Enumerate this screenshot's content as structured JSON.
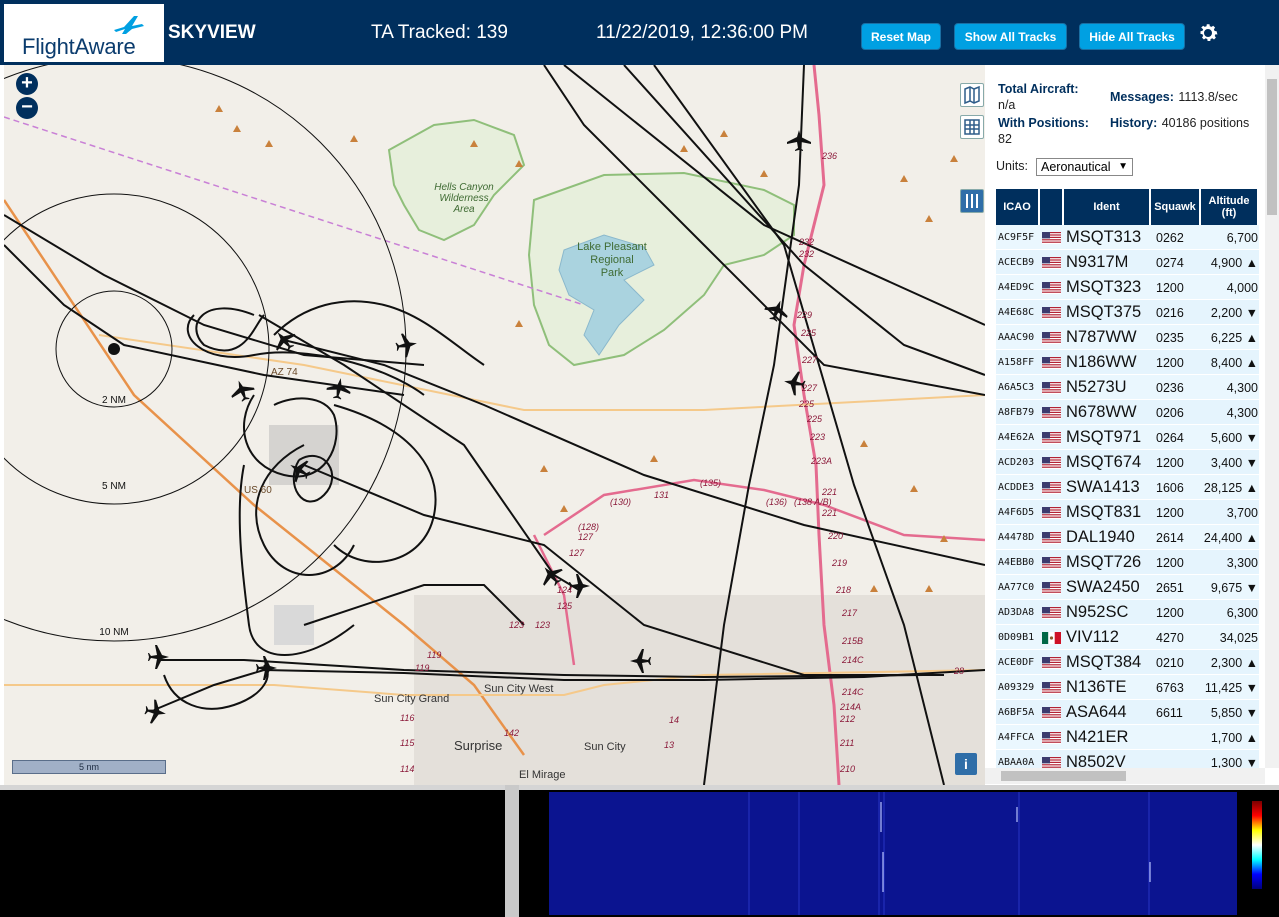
{
  "header": {
    "logo_text": "FlightAware",
    "app_title": "SKYVIEW",
    "tracked_label": "TA Tracked: 139",
    "datetime": "11/22/2019, 12:36:00 PM",
    "buttons": {
      "reset_map": "Reset Map",
      "show_all_tracks": "Show All Tracks",
      "hide_all_tracks": "Hide All Tracks"
    },
    "settings_icon": "gear-icon"
  },
  "map": {
    "zoom_in": "+",
    "zoom_out": "−",
    "range_rings": [
      "2 NM",
      "5 NM",
      "10 NM"
    ],
    "place_labels": {
      "hells_canyon": "Hells Canyon Wilderness Area",
      "lake_pleasant": "Lake Pleasant Regional Park",
      "sun_city_grand": "Sun City Grand",
      "sun_city_west": "Sun City West",
      "surprise": "Surprise",
      "sun_city": "Sun City",
      "el_mirage": "El Mirage"
    },
    "road_labels": [
      "AZ 74",
      "US 60"
    ],
    "exit_labels": [
      "236",
      "232",
      "232",
      "229",
      "225",
      "227",
      "227",
      "225",
      "223",
      "223A",
      "221",
      "221",
      "220",
      "219",
      "218",
      "217",
      "215B",
      "214C",
      "214C",
      "214A",
      "212",
      "211",
      "210",
      "(130)",
      "131",
      "(135)",
      "(136)",
      "(138 A/B)",
      "(128)",
      "127",
      "127",
      "124",
      "125",
      "123",
      "123",
      "119",
      "119",
      "116",
      "115",
      "114",
      "142",
      "14",
      "13",
      "28"
    ],
    "scale_label": "5 nm",
    "info_button": "i",
    "controls": [
      "map-layers-icon",
      "grid-icon",
      "columns-icon"
    ]
  },
  "panel": {
    "total_aircraft_label": "Total Aircraft:",
    "total_aircraft_value": "n/a",
    "with_positions_label": "With Positions:",
    "with_positions_value": "82",
    "messages_label": "Messages:",
    "messages_value": "1113.8/sec",
    "history_label": "History:",
    "history_value": "40186 positions",
    "units_label": "Units:",
    "units_value": "Aeronautical",
    "columns": [
      "ICAO",
      "",
      "Ident",
      "Squawk",
      "Altitude (ft)"
    ],
    "rows": [
      {
        "icao": "AC9F5F",
        "flag": "US",
        "ident": "MSQT313",
        "squawk": "0262",
        "alt": "6,700"
      },
      {
        "icao": "ACECB9",
        "flag": "US",
        "ident": "N9317M",
        "squawk": "0274",
        "alt": "4,900 ▲"
      },
      {
        "icao": "A4ED9C",
        "flag": "US",
        "ident": "MSQT323",
        "squawk": "1200",
        "alt": "4,000"
      },
      {
        "icao": "A4E68C",
        "flag": "US",
        "ident": "MSQT375",
        "squawk": "0216",
        "alt": "2,200 ▼"
      },
      {
        "icao": "AAAC90",
        "flag": "US",
        "ident": "N787WW",
        "squawk": "0235",
        "alt": "6,225 ▲"
      },
      {
        "icao": "A158FF",
        "flag": "US",
        "ident": "N186WW",
        "squawk": "1200",
        "alt": "8,400 ▲"
      },
      {
        "icao": "A6A5C3",
        "flag": "US",
        "ident": "N5273U",
        "squawk": "0236",
        "alt": "4,300"
      },
      {
        "icao": "A8FB79",
        "flag": "US",
        "ident": "N678WW",
        "squawk": "0206",
        "alt": "4,300"
      },
      {
        "icao": "A4E62A",
        "flag": "US",
        "ident": "MSQT971",
        "squawk": "0264",
        "alt": "5,600 ▼"
      },
      {
        "icao": "ACD203",
        "flag": "US",
        "ident": "MSQT674",
        "squawk": "1200",
        "alt": "3,400 ▼"
      },
      {
        "icao": "ACDDE3",
        "flag": "US",
        "ident": "SWA1413",
        "squawk": "1606",
        "alt": "28,125 ▲"
      },
      {
        "icao": "A4F6D5",
        "flag": "US",
        "ident": "MSQT831",
        "squawk": "1200",
        "alt": "3,700"
      },
      {
        "icao": "A4478D",
        "flag": "US",
        "ident": "DAL1940",
        "squawk": "2614",
        "alt": "24,400 ▲"
      },
      {
        "icao": "A4EBB0",
        "flag": "US",
        "ident": "MSQT726",
        "squawk": "1200",
        "alt": "3,300"
      },
      {
        "icao": "AA77C0",
        "flag": "US",
        "ident": "SWA2450",
        "squawk": "2651",
        "alt": "9,675 ▼"
      },
      {
        "icao": "AD3DA8",
        "flag": "US",
        "ident": "N952SC",
        "squawk": "1200",
        "alt": "6,300"
      },
      {
        "icao": "0D09B1",
        "flag": "MX",
        "ident": "VIV112",
        "squawk": "4270",
        "alt": "34,025"
      },
      {
        "icao": "ACE0DF",
        "flag": "US",
        "ident": "MSQT384",
        "squawk": "0210",
        "alt": "2,300 ▲"
      },
      {
        "icao": "A09329",
        "flag": "US",
        "ident": "N136TE",
        "squawk": "6763",
        "alt": "11,425 ▼"
      },
      {
        "icao": "A6BF5A",
        "flag": "US",
        "ident": "ASA644",
        "squawk": "6611",
        "alt": "5,850 ▼"
      },
      {
        "icao": "A4FFCA",
        "flag": "US",
        "ident": "N421ER",
        "squawk": "",
        "alt": "1,700 ▲"
      },
      {
        "icao": "ABAA0A",
        "flag": "US",
        "ident": "N8502V",
        "squawk": "",
        "alt": "1,300 ▼"
      }
    ]
  },
  "colors": {
    "header_bg": "#002f5d",
    "button_bg": "#00a0e2",
    "row_bg": "#e5f4fd",
    "map_bg": "#f2efe9"
  }
}
